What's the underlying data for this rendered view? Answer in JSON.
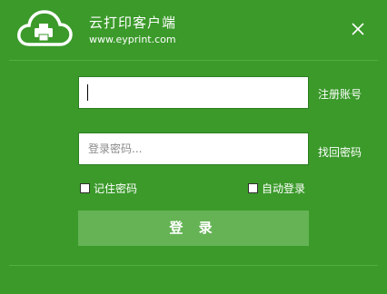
{
  "header": {
    "title": "云打印客户端",
    "url": "www.eyprint.com"
  },
  "login": {
    "username_value": "",
    "password_placeholder": "登录密码...",
    "register_label": "注册账号",
    "recover_label": "找回密码",
    "remember_label": "记住密码",
    "remember_checked": false,
    "autologin_label": "自动登录",
    "autologin_checked": false,
    "submit_label": "登 录"
  },
  "colors": {
    "background": "#3b9a2a",
    "button": "#65b355",
    "text": "#ffffff"
  },
  "icons": {
    "logo": "cloud-printer-icon",
    "close": "close-icon"
  }
}
